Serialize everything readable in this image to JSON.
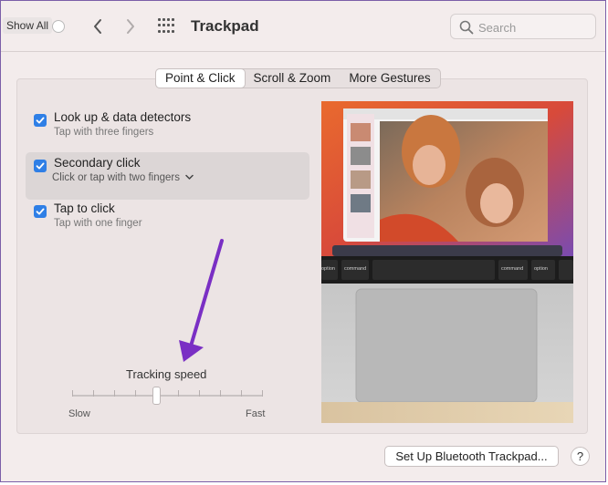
{
  "toolbar": {
    "show_all_label": "Show All",
    "title": "Trackpad",
    "search_placeholder": "Search"
  },
  "tabs": [
    {
      "label": "Point & Click",
      "active": true
    },
    {
      "label": "Scroll & Zoom",
      "active": false
    },
    {
      "label": "More Gestures",
      "active": false
    }
  ],
  "options": [
    {
      "title": "Look up & data detectors",
      "subtitle": "Tap with three fingers",
      "checked": true
    },
    {
      "title": "Secondary click",
      "subtitle": "Click or tap with two fingers",
      "checked": true,
      "has_dropdown": true
    },
    {
      "title": "Tap to click",
      "subtitle": "Tap with one finger",
      "checked": true
    }
  ],
  "tracking": {
    "label": "Tracking speed",
    "min_label": "Slow",
    "max_label": "Fast",
    "tick_count": 10,
    "value_fraction": 0.44
  },
  "preview": {
    "touchbar_keys": [
      "option",
      "command",
      "command",
      "option"
    ],
    "touchbar_symbols": [
      "alt",
      "⌘",
      "⌘",
      "alt"
    ]
  },
  "footer": {
    "bluetooth_button_label": "Set Up Bluetooth Trackpad...",
    "help_label": "?"
  },
  "colors": {
    "accent": "#2f7fe6",
    "annotation_arrow": "#7a2fc4"
  }
}
